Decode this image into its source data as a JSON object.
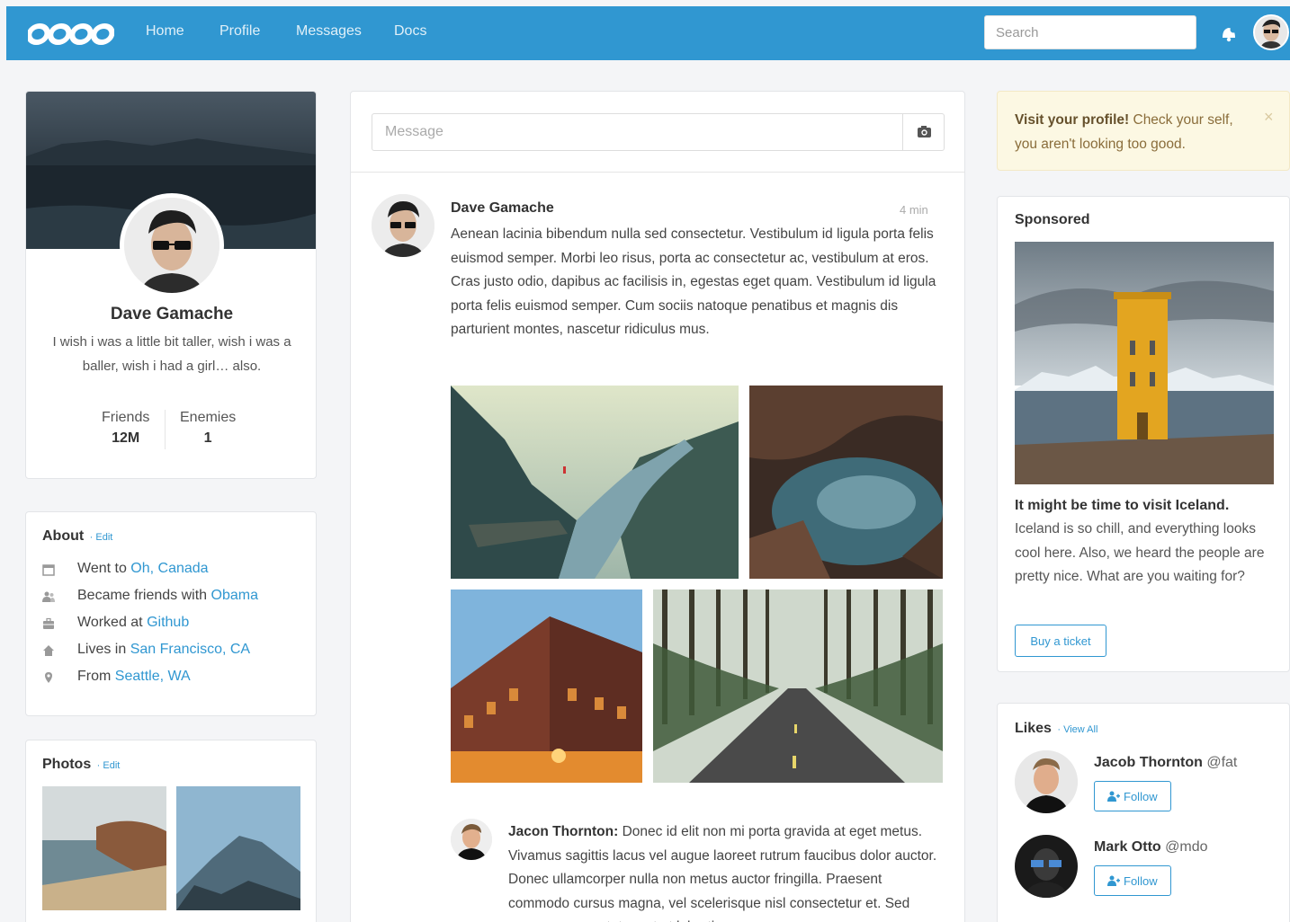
{
  "navbar": {
    "brand": "oooo",
    "links": [
      "Home",
      "Profile",
      "Messages",
      "Docs"
    ],
    "search_placeholder": "Search"
  },
  "profile": {
    "name": "Dave Gamache",
    "bio": "I wish i was a little bit taller, wish i was a baller, wish i had a girl… also.",
    "stats": [
      {
        "label": "Friends",
        "value": "12M"
      },
      {
        "label": "Enemies",
        "value": "1"
      }
    ]
  },
  "about": {
    "title": "About",
    "edit": "· Edit",
    "items": [
      {
        "icon": "calendar-icon",
        "text": "Went to ",
        "link": "Oh, Canada"
      },
      {
        "icon": "users-icon",
        "text": "Became friends with ",
        "link": "Obama"
      },
      {
        "icon": "briefcase-icon",
        "text": "Worked at ",
        "link": "Github"
      },
      {
        "icon": "home-icon",
        "text": "Lives in ",
        "link": "San Francisco, CA"
      },
      {
        "icon": "location-icon",
        "text": "From ",
        "link": "Seattle, WA"
      }
    ]
  },
  "photos": {
    "title": "Photos",
    "edit": "· Edit"
  },
  "composer": {
    "placeholder": "Message"
  },
  "post": {
    "author": "Dave Gamache",
    "time": "4 min",
    "body": "Aenean lacinia bibendum nulla sed consectetur. Vestibulum id ligula porta felis euismod semper. Morbi leo risus, porta ac consectetur ac, vestibulum at eros. Cras justo odio, dapibus ac facilisis in, egestas eget quam. Vestibulum id ligula porta felis euismod semper. Cum sociis natoque penatibus et magnis dis parturient montes, nascetur ridiculus mus."
  },
  "reply": {
    "author": "Jacon Thornton:",
    "body": " Donec id elit non mi porta gravida at eget metus. Vivamus sagittis lacus vel augue laoreet rutrum faucibus dolor auctor. Donec ullamcorper nulla non metus auctor fringilla. Praesent commodo cursus magna, vel scelerisque nisl consectetur et. Sed posuere consectetur est at lobortis."
  },
  "alert": {
    "strong": "Visit your profile!",
    "text": " Check your self, you aren't looking too good.",
    "close": "×"
  },
  "sponsored": {
    "title": "Sponsored",
    "headline": "It might be time to visit Iceland.",
    "body": "Iceland is so chill, and everything looks cool here. Also, we heard the people are pretty nice. What are you waiting for?",
    "button": "Buy a ticket"
  },
  "likes": {
    "title": "Likes",
    "view_all": "· View All",
    "people": [
      {
        "name": "Jacob Thornton",
        "handle": "@fat",
        "button": "Follow"
      },
      {
        "name": "Mark Otto",
        "handle": "@mdo",
        "button": "Follow"
      }
    ]
  }
}
